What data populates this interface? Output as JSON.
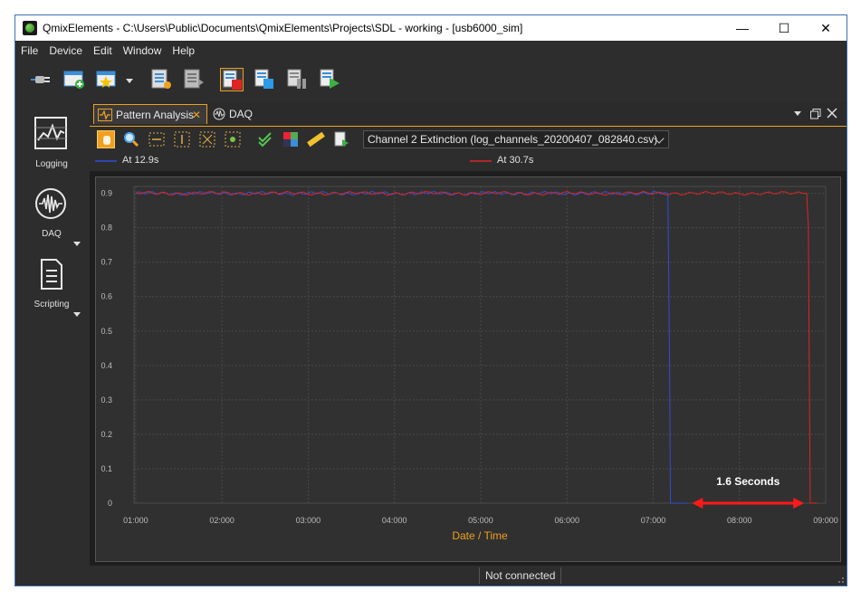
{
  "window": {
    "title": "QmixElements - C:\\Users\\Public\\Documents\\QmixElements\\Projects\\SDL - working - [usb6000_sim]",
    "minimize": "—",
    "maximize": "☐",
    "close": "✕"
  },
  "menu": [
    "File",
    "Device",
    "Edit",
    "Window",
    "Help"
  ],
  "sidebar": {
    "items": [
      {
        "label": "Logging",
        "icon": "chart-icon"
      },
      {
        "label": "DAQ",
        "icon": "waveform-icon"
      },
      {
        "label": "Scripting",
        "icon": "document-icon"
      }
    ]
  },
  "tabs": [
    {
      "label": "Pattern Analysis",
      "close": "✕"
    },
    {
      "label": "DAQ"
    }
  ],
  "channel_select": {
    "value": "Channel 2 Extinction (log_channels_20200407_082840.csv)"
  },
  "cursors": [
    {
      "label": "At 12.9s",
      "color": "#2f4fd6"
    },
    {
      "label": "At 30.7s",
      "color": "#d42a2a"
    }
  ],
  "annotation": "1.6 Seconds",
  "status": {
    "connection": "Not connected"
  },
  "colors": {
    "accent": "#f0a020",
    "series_blue": "#2f4fd6",
    "series_red": "#e02424"
  },
  "chart_data": {
    "type": "line",
    "xlabel": "Date / Time",
    "ylabel": "",
    "x_ticks": [
      "01:000",
      "02:000",
      "03:000",
      "04:000",
      "05:000",
      "06:000",
      "07:000",
      "08:000",
      "09:000"
    ],
    "y_ticks": [
      "0",
      "0.1",
      "0.2",
      "0.3",
      "0.4",
      "0.5",
      "0.6",
      "0.7",
      "0.8",
      "0.9"
    ],
    "xlim": [
      0.98,
      9.0
    ],
    "ylim": [
      0,
      0.92
    ],
    "grid": true,
    "series": [
      {
        "name": "At 12.9s",
        "color": "#2f4fd6",
        "x": [
          1.0,
          7.17,
          7.19,
          7.2,
          7.22,
          7.3,
          7.4
        ],
        "y": [
          0.9,
          0.9,
          0.4,
          0.0,
          0.0,
          0.0,
          0.0
        ]
      },
      {
        "name": "At 30.7s",
        "color": "#e02424",
        "x": [
          1.0,
          8.78,
          8.8,
          8.82,
          8.85,
          8.9
        ],
        "y": [
          0.9,
          0.9,
          0.8,
          0.0,
          0.0,
          0.0
        ]
      }
    ]
  }
}
